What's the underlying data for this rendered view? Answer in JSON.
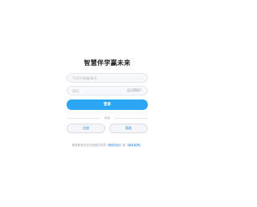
{
  "app": {
    "title": "智慧伴学赢未来"
  },
  "form": {
    "account_placeholder": "手机号/邮箱/账号",
    "password_placeholder": "密码",
    "forgot_label": "忘记密码？",
    "login_label": "登录",
    "divider_label": "或者",
    "register_label": "注册",
    "help_label": "帮助"
  },
  "agreement": {
    "prefix": "登录即表示您已阅读并同意",
    "user_terms": "《服务协议》",
    "and": "和",
    "privacy": "《隐私政策》"
  },
  "colors": {
    "primary": "#2ba6f5",
    "link": "#2a7fd8"
  }
}
